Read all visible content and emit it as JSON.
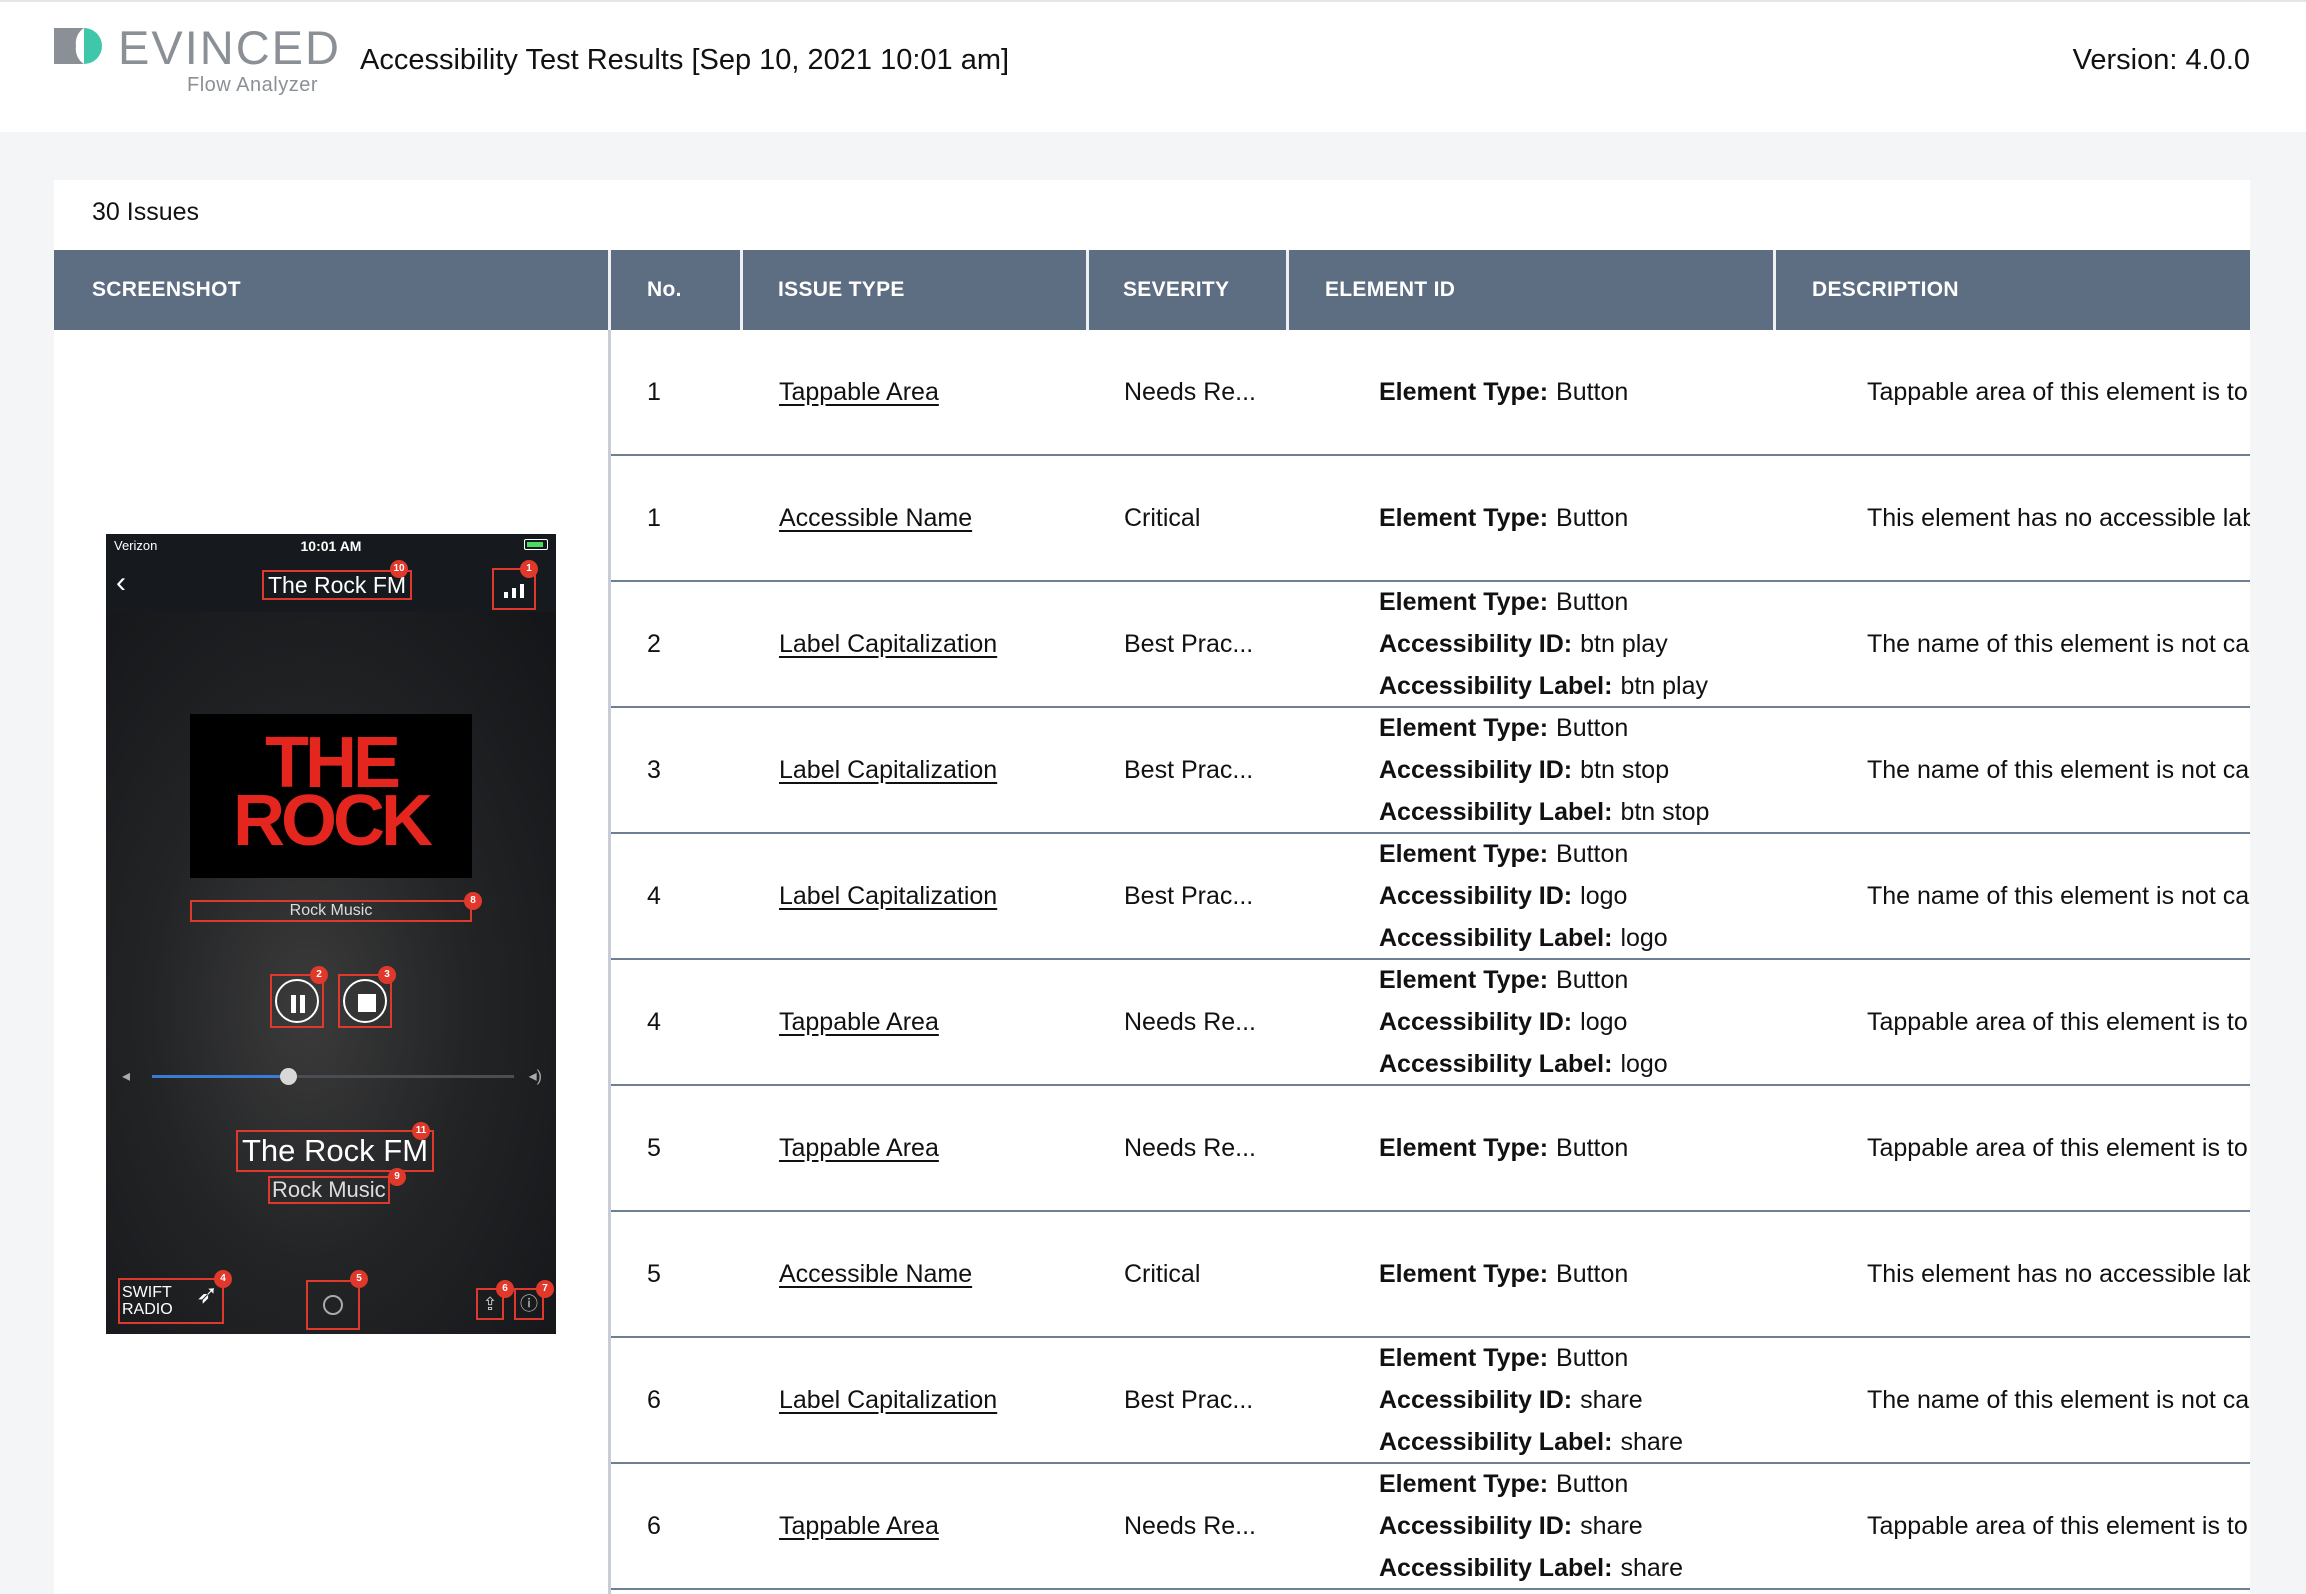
{
  "header": {
    "brand": "EVINCED",
    "product": "Flow Analyzer",
    "title": "Accessibility Test Results [Sep 10, 2021 10:01 am]",
    "version": "Version: 4.0.0"
  },
  "summary": {
    "issues_count": "30 Issues"
  },
  "table": {
    "columns": {
      "screenshot": "SCREENSHOT",
      "no": "No.",
      "issue_type": "ISSUE TYPE",
      "severity": "SEVERITY",
      "element_id": "ELEMENT ID",
      "description": "DESCRIPTION"
    },
    "labels": {
      "element_type": "Element Type:",
      "accessibility_id": "Accessibility ID:",
      "accessibility_label": "Accessibility Label:"
    },
    "rows": [
      {
        "no": "1",
        "type": "Tappable Area",
        "severity": "Needs Re...",
        "element_type": "Button",
        "description": "Tappable area of this element is to..."
      },
      {
        "no": "1",
        "type": "Accessible Name",
        "severity": "Critical",
        "element_type": "Button",
        "description": "This element has no accessible lab..."
      },
      {
        "no": "2",
        "type": "Label Capitalization",
        "severity": "Best Prac...",
        "element_type": "Button",
        "accessibility_id": "btn play",
        "accessibility_label": "btn play",
        "description": "The name of this element is not ca..."
      },
      {
        "no": "3",
        "type": "Label Capitalization",
        "severity": "Best Prac...",
        "element_type": "Button",
        "accessibility_id": "btn stop",
        "accessibility_label": "btn stop",
        "description": "The name of this element is not ca..."
      },
      {
        "no": "4",
        "type": "Label Capitalization",
        "severity": "Best Prac...",
        "element_type": "Button",
        "accessibility_id": "logo",
        "accessibility_label": "logo",
        "description": "The name of this element is not ca..."
      },
      {
        "no": "4",
        "type": "Tappable Area",
        "severity": "Needs Re...",
        "element_type": "Button",
        "accessibility_id": "logo",
        "accessibility_label": "logo",
        "description": "Tappable area of this element is to..."
      },
      {
        "no": "5",
        "type": "Tappable Area",
        "severity": "Needs Re...",
        "element_type": "Button",
        "description": "Tappable area of this element is to..."
      },
      {
        "no": "5",
        "type": "Accessible Name",
        "severity": "Critical",
        "element_type": "Button",
        "description": "This element has no accessible lab..."
      },
      {
        "no": "6",
        "type": "Label Capitalization",
        "severity": "Best Prac...",
        "element_type": "Button",
        "accessibility_id": "share",
        "accessibility_label": "share",
        "description": "The name of this element is not ca..."
      },
      {
        "no": "6",
        "type": "Tappable Area",
        "severity": "Needs Re...",
        "element_type": "Button",
        "accessibility_id": "share",
        "accessibility_label": "share",
        "description": "Tappable area of this element is to..."
      }
    ]
  },
  "phone": {
    "carrier": "Verizon",
    "time": "10:01 AM",
    "nav_title": "The Rock FM",
    "album_line1": "THE",
    "album_line2": "ROCK",
    "genre": "Rock Music",
    "song": "The Rock FM",
    "artist": "Rock Music",
    "swift_line1": "SWIFT",
    "swift_line2": "RADIO",
    "badges": {
      "bars": "1",
      "title": "10",
      "genre": "8",
      "pause": "2",
      "stop": "3",
      "song": "11",
      "artist": "9",
      "swift": "4",
      "air": "5",
      "share": "6",
      "info": "7"
    }
  },
  "colors": {
    "header_bg": "#5d6d82",
    "highlight": "#e0382a",
    "logo_teal": "#3ec7a9"
  }
}
